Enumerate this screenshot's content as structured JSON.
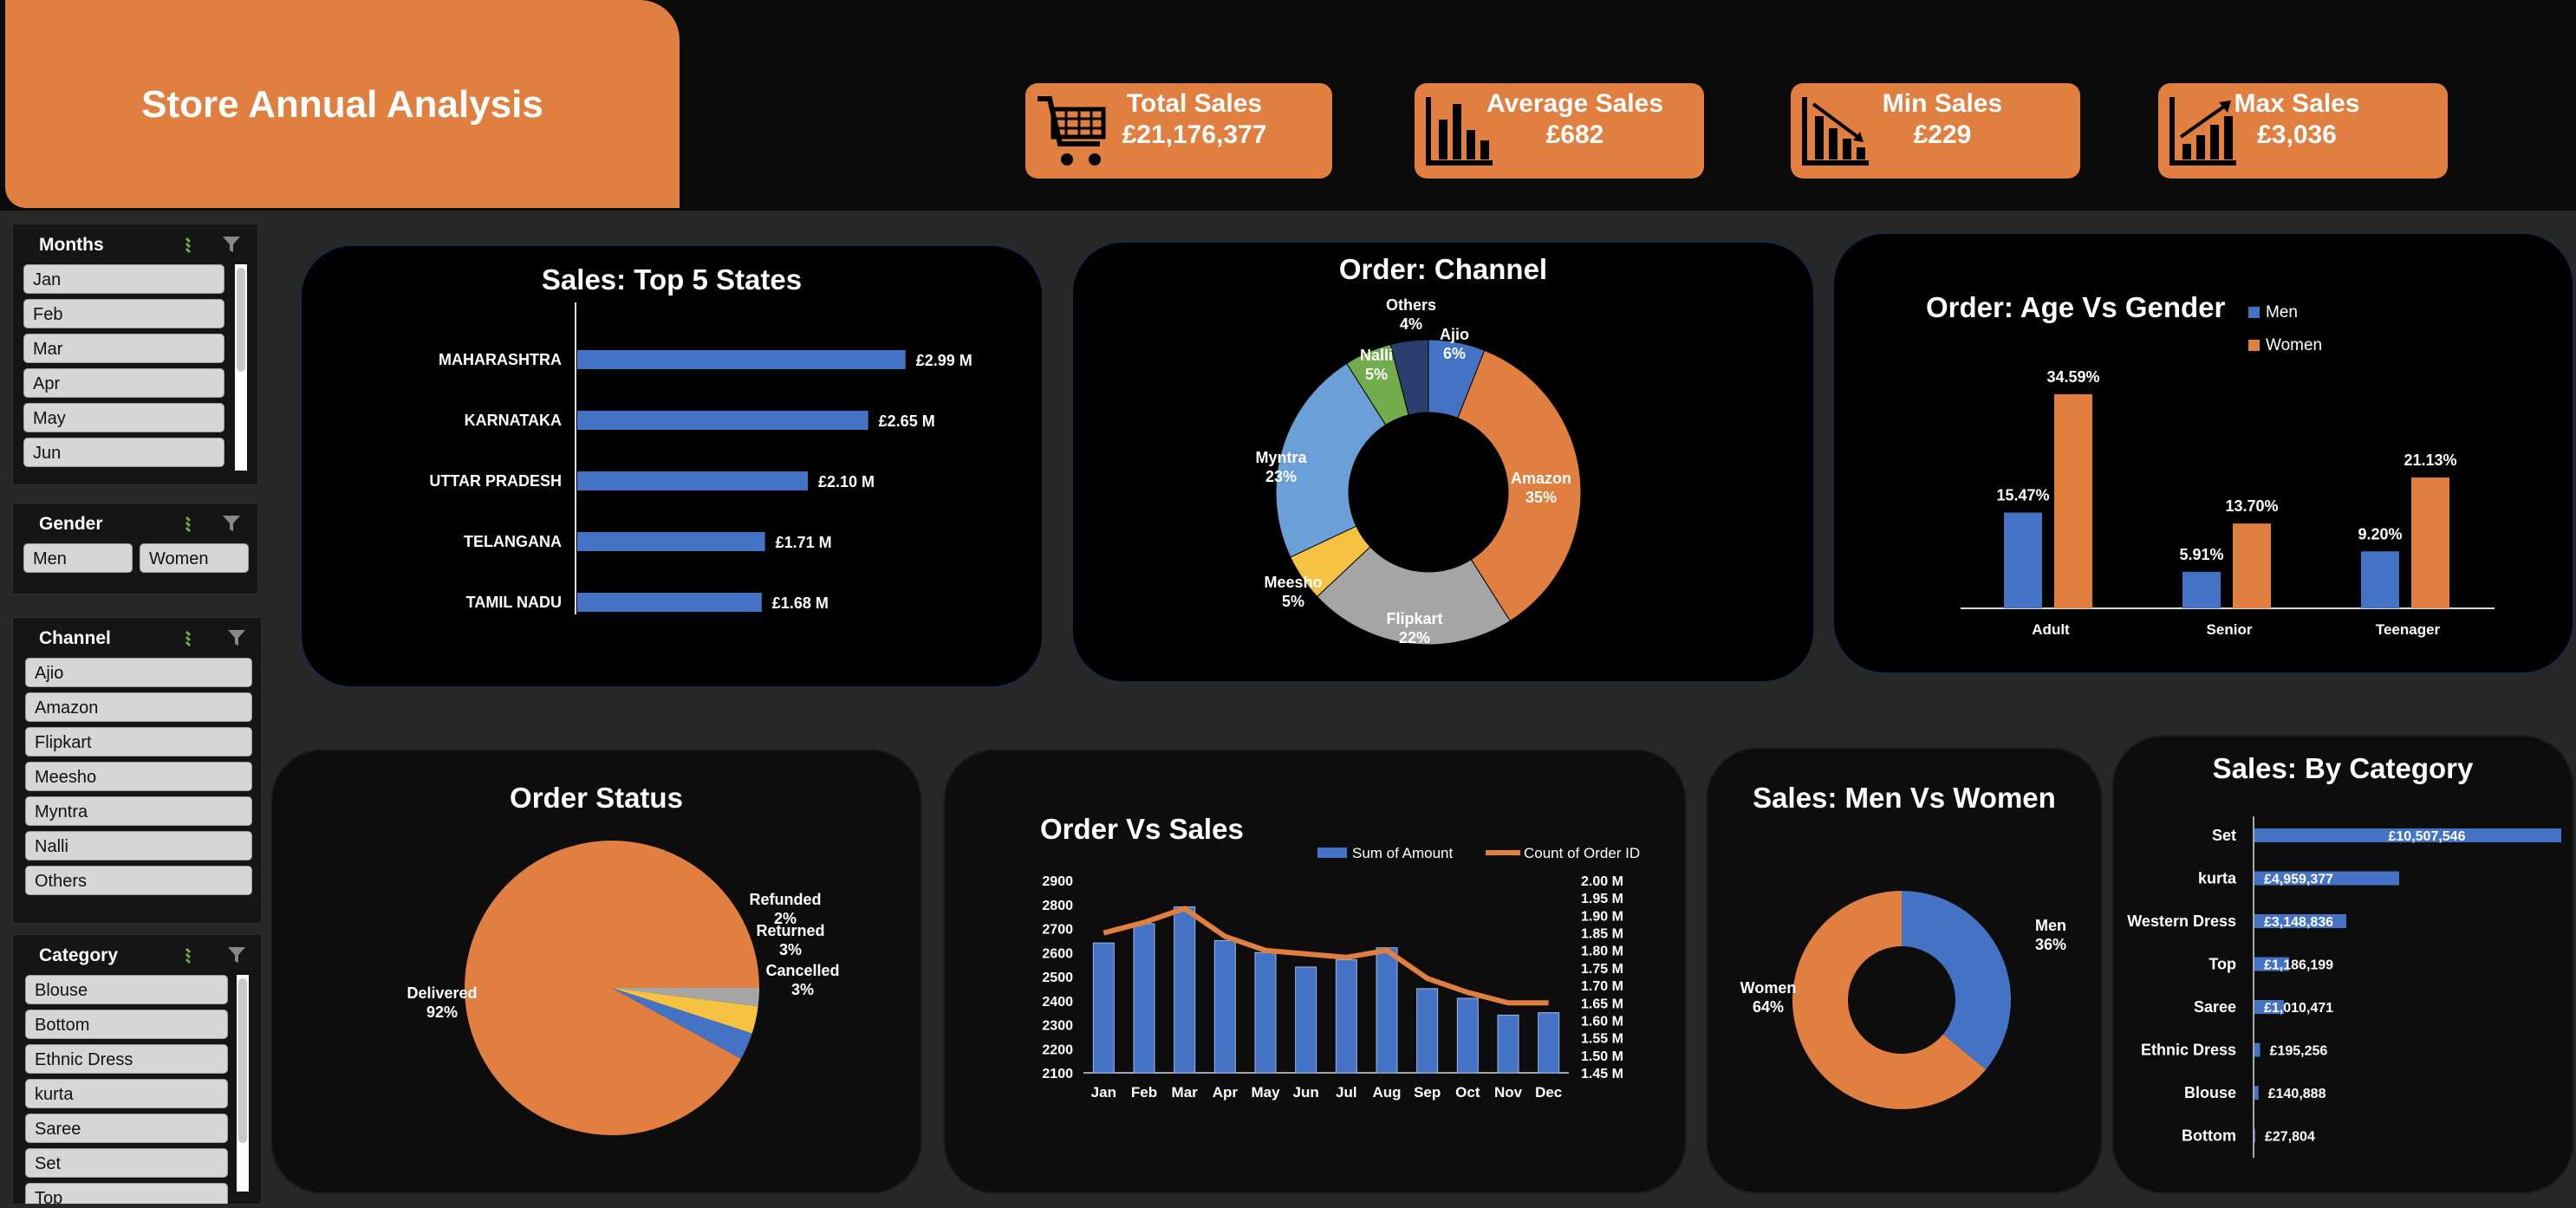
{
  "header": {
    "title": "Store Annual Analysis"
  },
  "kpis": [
    {
      "label": "Total Sales",
      "value": "£21,176,377",
      "icon": "cart-icon"
    },
    {
      "label": "Average Sales",
      "value": "£682",
      "icon": "bar-chart-icon"
    },
    {
      "label": "Min Sales",
      "value": "£229",
      "icon": "chart-down-icon"
    },
    {
      "label": "Max Sales",
      "value": "£3,036",
      "icon": "chart-up-icon"
    }
  ],
  "slicers": {
    "months": {
      "title": "Months",
      "items": [
        "Jan",
        "Feb",
        "Mar",
        "Apr",
        "May",
        "Jun"
      ]
    },
    "gender": {
      "title": "Gender",
      "items": [
        "Men",
        "Women"
      ]
    },
    "channel": {
      "title": "Channel",
      "items": [
        "Ajio",
        "Amazon",
        "Flipkart",
        "Meesho",
        "Myntra",
        "Nalli",
        "Others"
      ]
    },
    "category": {
      "title": "Category",
      "items": [
        "Blouse",
        "Bottom",
        "Ethnic Dress",
        "kurta",
        "Saree",
        "Set",
        "Top"
      ]
    }
  },
  "colors": {
    "orange": "#e07f3f",
    "blue": "#4472c4",
    "gray": "#a5a5a5",
    "yellow": "#f5c242",
    "lightblue": "#6a9fd8",
    "green": "#72ac4d",
    "navy": "#2a3f6e"
  },
  "chart_data": [
    {
      "id": "top-states",
      "type": "bar",
      "title": "Sales: Top 5 States",
      "categories": [
        "MAHARASHTRA",
        "KARNATAKA",
        "UTTAR PRADESH",
        "TELANGANA",
        "TAMIL NADU"
      ],
      "values": [
        2.99,
        2.65,
        2.1,
        1.71,
        1.68
      ],
      "labels": [
        "£2.99 M",
        "£2.65 M",
        "£2.10 M",
        "£1.71 M",
        "£1.68 M"
      ]
    },
    {
      "id": "channel",
      "type": "pie",
      "title": "Order: Channel",
      "categories": [
        "Ajio",
        "Amazon",
        "Flipkart",
        "Meesho",
        "Myntra",
        "Nalli",
        "Others"
      ],
      "values": [
        6,
        35,
        22,
        5,
        23,
        5,
        4
      ],
      "labels": [
        "6%",
        "35%",
        "22%",
        "5%",
        "23%",
        "5%",
        "4%"
      ]
    },
    {
      "id": "age-gender",
      "type": "bar",
      "title": "Order: Age Vs Gender",
      "categories": [
        "Adult",
        "Senior",
        "Teenager"
      ],
      "series": [
        {
          "name": "Men",
          "values": [
            15.47,
            5.91,
            9.2
          ],
          "labels": [
            "15.47%",
            "5.91%",
            "9.20%"
          ]
        },
        {
          "name": "Women",
          "values": [
            34.59,
            13.7,
            21.13
          ],
          "labels": [
            "34.59%",
            "13.70%",
            "21.13%"
          ]
        }
      ],
      "legend": "top-right"
    },
    {
      "id": "order-status",
      "type": "pie",
      "title": "Order Status",
      "categories": [
        "Delivered",
        "Refunded",
        "Returned",
        "Cancelled"
      ],
      "values": [
        92,
        2,
        3,
        3
      ],
      "labels": [
        "92%",
        "2%",
        "3%",
        "3%"
      ]
    },
    {
      "id": "order-vs-sales",
      "type": "bar",
      "title": "Order Vs Sales",
      "categories": [
        "Jan",
        "Feb",
        "Mar",
        "Apr",
        "May",
        "Jun",
        "Jul",
        "Aug",
        "Sep",
        "Oct",
        "Nov",
        "Dec"
      ],
      "series": [
        {
          "name": "Sum of Amount",
          "type": "bar",
          "values": [
            2640,
            2720,
            2790,
            2650,
            2600,
            2540,
            2570,
            2620,
            2450,
            2410,
            2340,
            2350
          ]
        },
        {
          "name": "Count of Order ID",
          "type": "line",
          "values": [
            1.85,
            1.88,
            1.92,
            1.84,
            1.8,
            1.79,
            1.78,
            1.8,
            1.72,
            1.68,
            1.65,
            1.65
          ]
        }
      ],
      "y_left_ticks": [
        "2100",
        "2200",
        "2300",
        "2400",
        "2500",
        "2600",
        "2700",
        "2800",
        "2900"
      ],
      "y_right_ticks": [
        "1.45 M",
        "1.50 M",
        "1.55 M",
        "1.60 M",
        "1.65 M",
        "1.70 M",
        "1.75 M",
        "1.80 M",
        "1.85 M",
        "1.90 M",
        "1.95 M",
        "2.00 M"
      ],
      "ylim_left": [
        2100,
        2900
      ],
      "ylim_right": [
        1.45,
        2.0
      ],
      "legend": "top-right"
    },
    {
      "id": "men-women",
      "type": "pie",
      "title": "Sales: Men Vs Women",
      "categories": [
        "Men",
        "Women"
      ],
      "values": [
        36,
        64
      ],
      "labels": [
        "36%",
        "64%"
      ]
    },
    {
      "id": "category",
      "type": "bar",
      "title": "Sales: By Category",
      "categories": [
        "Set",
        "kurta",
        "Western Dress",
        "Top",
        "Saree",
        "Ethnic Dress",
        "Blouse",
        "Bottom"
      ],
      "values": [
        10507546,
        4959377,
        3148836,
        1186199,
        1010471,
        195256,
        140888,
        27804
      ],
      "labels": [
        "£10,507,546",
        "£4,959,377",
        "£3,148,836",
        "£1,186,199",
        "£1,010,471",
        "£195,256",
        "£140,888",
        "£27,804"
      ]
    }
  ]
}
